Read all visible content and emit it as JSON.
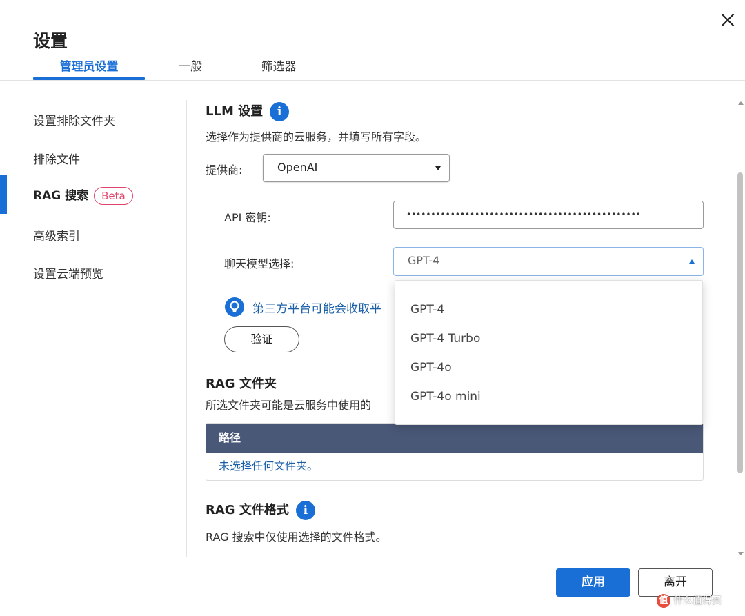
{
  "dialog": {
    "title": "设置",
    "close_icon": "close-icon"
  },
  "tabs": [
    {
      "label": "管理员设置",
      "active": true
    },
    {
      "label": "一般",
      "active": false
    },
    {
      "label": "筛选器",
      "active": false
    }
  ],
  "sidebar": {
    "items": [
      {
        "label": "设置排除文件夹"
      },
      {
        "label": "排除文件"
      },
      {
        "label": "RAG 搜索",
        "badge": "Beta",
        "active": true
      },
      {
        "label": "高级索引"
      },
      {
        "label": "设置云端预览"
      }
    ]
  },
  "llm": {
    "title": "LLM 设置",
    "desc": "选择作为提供商的云服务，并填写所有字段。",
    "provider_label": "提供商:",
    "provider_value": "OpenAI",
    "api_key_label": "API 密钥:",
    "api_key_value": "••••••••••••••••••••••••••••••••••••••••••••••••",
    "model_label": "聊天模型选择:",
    "model_value": "GPT-4",
    "notice": "第三方平台可能会收取平",
    "verify_label": "验证"
  },
  "model_dropdown": {
    "options": [
      "GPT-4",
      "GPT-4 Turbo",
      "GPT-4o",
      "GPT-4o mini"
    ]
  },
  "rag_folder": {
    "title": "RAG 文件夹",
    "desc": "所选文件夹可能是云服务中使用的",
    "table_header": "路径",
    "empty_row": "未选择任何文件夹。"
  },
  "rag_format": {
    "title": "RAG 文件格式",
    "desc": "RAG 搜索中仅使用选择的文件格式。"
  },
  "footer": {
    "apply_label": "应用",
    "leave_label": "离开"
  },
  "watermark": {
    "logo": "值",
    "text": "什么值得买"
  },
  "colors": {
    "accent": "#1a6fd6",
    "badge": "#e0446a",
    "table_header": "#4a5878",
    "link_text": "#1a5fa8"
  }
}
